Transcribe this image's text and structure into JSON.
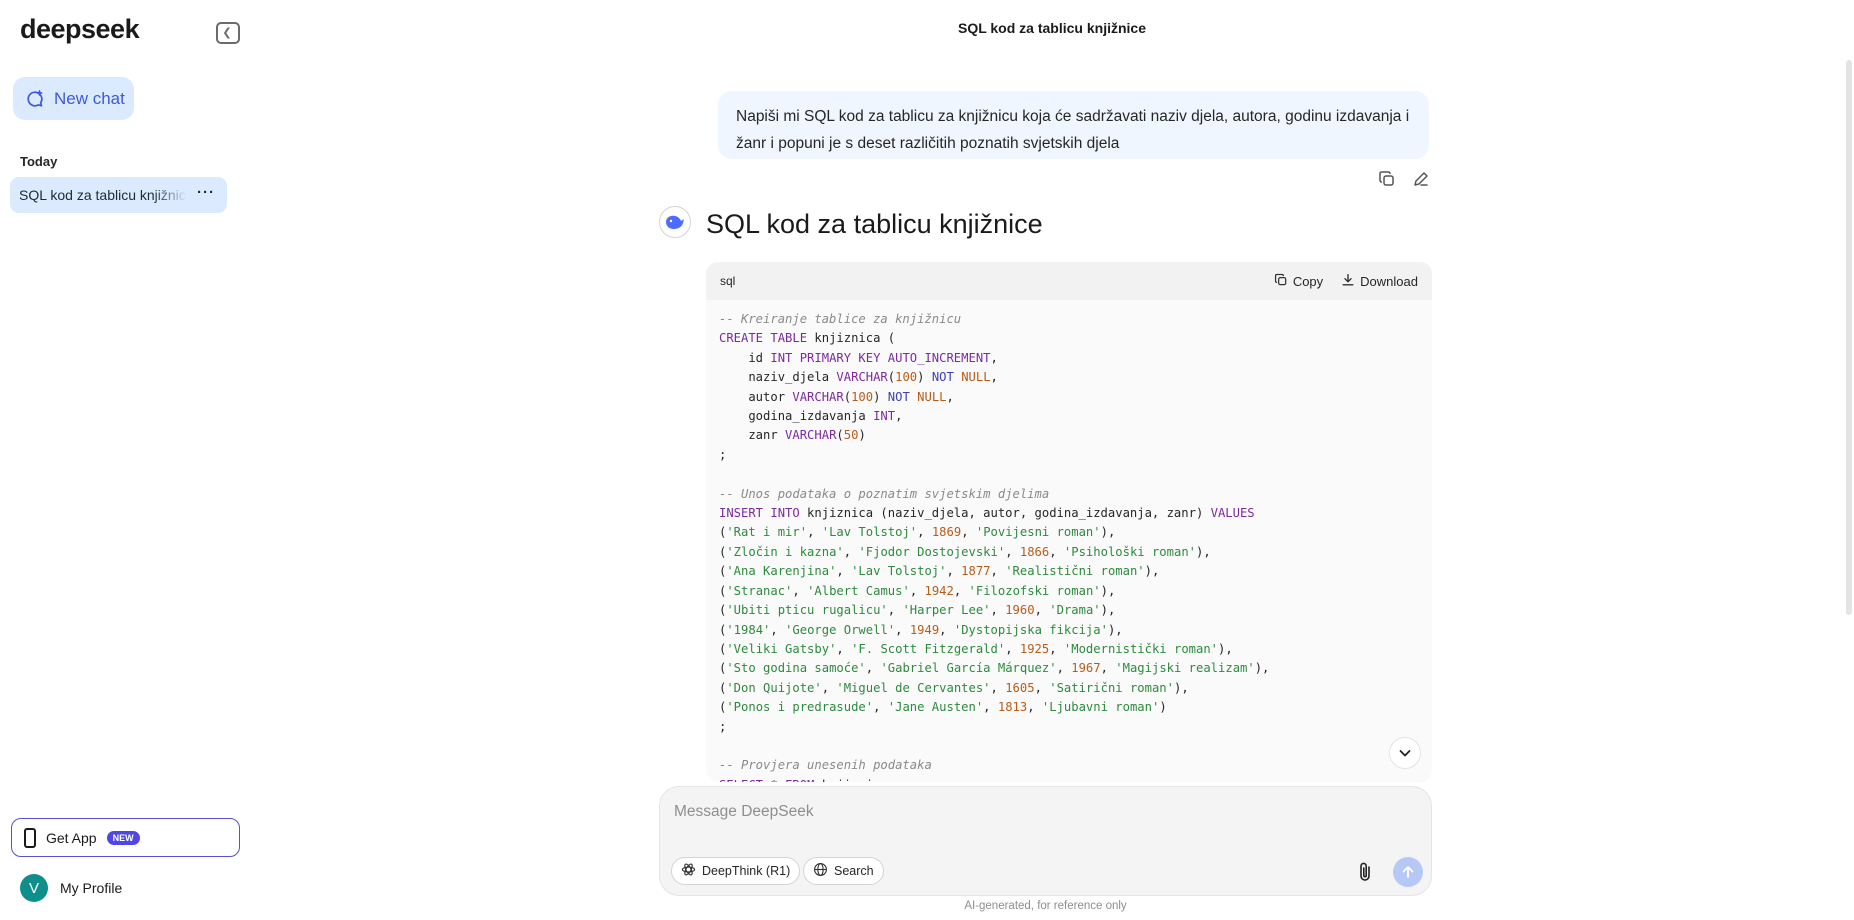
{
  "sidebar": {
    "logo": "deepseek",
    "new_chat_label": "New chat",
    "section_today": "Today",
    "chat_items": [
      {
        "label": "SQL kod za tablicu knjižnice"
      }
    ],
    "get_app_label": "Get App",
    "get_app_badge": "NEW",
    "profile_initial": "V",
    "profile_label": "My Profile"
  },
  "header": {
    "title": "SQL kod za tablicu knjižnice"
  },
  "conversation": {
    "user_message": "Napiši mi SQL kod za tablicu za knjižnicu koja će sadržavati naziv djela, autora, godinu izdavanja i žanr i popuni je s deset različitih poznatih svjetskih djela",
    "answer_title": "SQL kod za tablicu knjižnice",
    "code_block": {
      "language": "sql",
      "copy_label": "Copy",
      "download_label": "Download"
    }
  },
  "composer": {
    "placeholder": "Message DeepSeek",
    "deepthink_label": "DeepThink (R1)",
    "search_label": "Search"
  },
  "footer": {
    "disclaimer": "AI-generated, for reference only"
  },
  "colors": {
    "accent": "#4f46e5",
    "sidebar_highlight": "#dbeafe",
    "user_bubble": "#eff6ff"
  }
}
